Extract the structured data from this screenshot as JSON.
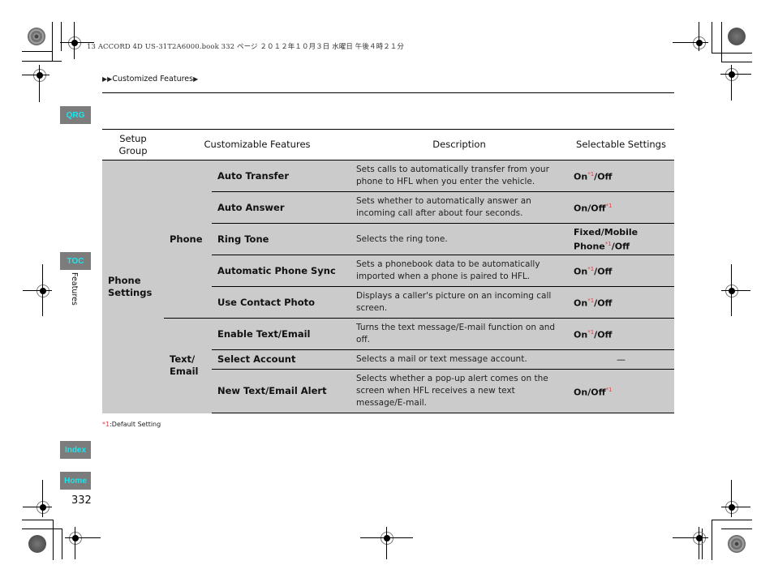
{
  "print_header": "13 ACCORD 4D US-31T2A6000.book  332 ページ  ２０１２年１０月３日  水曜日  午後４時２１分",
  "breadcrumb": {
    "prefix_icon": "double-triangle-right-icon",
    "label": "Customized Features",
    "suffix_icon": "triangle-right-icon"
  },
  "side_nav": {
    "qrg": "QRG",
    "toc": "TOC",
    "section": "Features",
    "index": "Index",
    "home": "Home"
  },
  "page_number": "332",
  "table": {
    "headers": [
      "Setup\nGroup",
      "Customizable Features",
      "Description",
      "Selectable Settings"
    ],
    "group": "Phone Settings",
    "subgroups": [
      {
        "name": "Phone",
        "rows": [
          {
            "feature": "Auto Transfer",
            "description": "Sets calls to automatically transfer from your phone to HFL when you enter the vehicle.",
            "settings": [
              {
                "text": "On",
                "default": true
              },
              {
                "text": "Off",
                "default": false
              }
            ]
          },
          {
            "feature": "Auto Answer",
            "description": "Sets whether to automatically answer an incoming call after about four seconds.",
            "settings": [
              {
                "text": "On",
                "default": false
              },
              {
                "text": "Off",
                "default": true
              }
            ]
          },
          {
            "feature": "Ring Tone",
            "description": "Selects the ring tone.",
            "settings": [
              {
                "text": "Fixed",
                "default": false
              },
              {
                "text": "Mobile Phone",
                "default": true
              },
              {
                "text": "Off",
                "default": false
              }
            ]
          },
          {
            "feature": "Automatic Phone Sync",
            "description": "Sets a phonebook data to be automatically imported when a phone is paired to HFL.",
            "settings": [
              {
                "text": "On",
                "default": true
              },
              {
                "text": "Off",
                "default": false
              }
            ]
          },
          {
            "feature": "Use Contact Photo",
            "description": "Displays a caller's picture on an incoming call screen.",
            "settings": [
              {
                "text": "On",
                "default": true
              },
              {
                "text": "Off",
                "default": false
              }
            ]
          }
        ]
      },
      {
        "name": "Text/ Email",
        "rows": [
          {
            "feature": "Enable Text/Email",
            "description": "Turns the text message/E-mail function on and off.",
            "settings": [
              {
                "text": "On",
                "default": true
              },
              {
                "text": "Off",
                "default": false
              }
            ]
          },
          {
            "feature": "Select Account",
            "description": "Selects a mail or text message account.",
            "settings": [],
            "empty_mark": "—"
          },
          {
            "feature": "New Text/Email Alert",
            "description": "Selects whether a pop-up alert comes on the screen when HFL receives a new text message/E-mail.",
            "settings": [
              {
                "text": "On",
                "default": false
              },
              {
                "text": "Off",
                "default": true
              }
            ]
          }
        ]
      }
    ]
  },
  "footnote_mark": "*1",
  "footnote": {
    "mark": "*1",
    "text": ":Default Setting"
  },
  "colors": {
    "accent_nav_text": "#19e6ee",
    "nav_bg": "#7c7c7c",
    "table_body_bg": "#cbcbcb",
    "default_mark": "#e0424a"
  }
}
